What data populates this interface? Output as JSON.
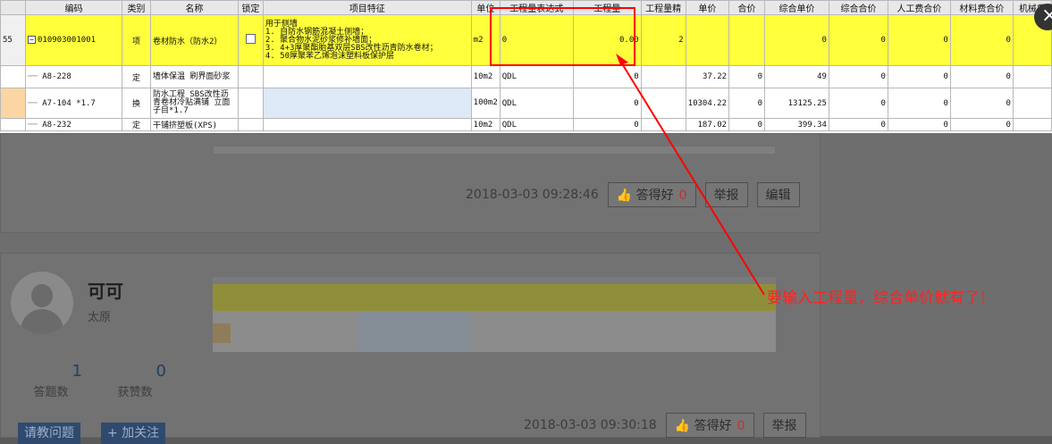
{
  "sheet": {
    "headers": [
      "编码",
      "类别",
      "名称",
      "锁定",
      "项目特征",
      "单位",
      "工程量表达式",
      "工程量",
      "工程量精",
      "单价",
      "合价",
      "综合单价",
      "综合合价",
      "人工费合价",
      "材料费合价",
      "机械费"
    ],
    "main_row": {
      "rownum": "55",
      "code": "010903001001",
      "type": "项",
      "name": "卷材防水（防水2）",
      "feature_lines": [
        "用于侧墙",
        "1. 自防水钢筋混凝土侧墙；",
        "2. 聚合物水泥砂浆修补墙面；",
        "3. 4+3厚聚酯胎基双层SBS改性沥青防水卷材；",
        "4. 50厚聚苯乙烯泡沫塑料板保护层"
      ],
      "unit": "m2",
      "expr": "0",
      "qty": "0.00",
      "precision": "2",
      "comp_price": "0",
      "comp_total": "0",
      "labor": "0",
      "material": "0"
    },
    "sub_rows": [
      {
        "code": "A8-228",
        "type": "定",
        "name": "墙体保温 刷界面砂浆",
        "unit": "10m2",
        "expr": "QDL",
        "qty": "0",
        "unit_price": "37.22",
        "total": "0",
        "comp_price": "49",
        "comp_total": "0",
        "labor": "0",
        "material": "0"
      },
      {
        "code": "A7-104 *1.7",
        "type": "换",
        "name": "防水工程 SBS改性沥青卷材冷贴满铺 立面 子目*1.7",
        "unit": "100m2",
        "expr": "QDL",
        "qty": "0",
        "unit_price": "10304.22",
        "total": "0",
        "comp_price": "13125.25",
        "comp_total": "0",
        "labor": "0",
        "material": "0"
      },
      {
        "code": "A8-232",
        "type": "定",
        "name": "干铺挤塑板(XPS)",
        "unit": "10m2",
        "expr": "QDL",
        "qty": "0",
        "unit_price": "187.02",
        "total": "0",
        "comp_price": "399.34",
        "comp_total": "0",
        "labor": "0",
        "material": "0"
      }
    ]
  },
  "answer1": {
    "timestamp": "2018-03-03 09:28:46",
    "like_label": "答得好",
    "like_count": "0",
    "report_label": "举报",
    "edit_label": "编辑"
  },
  "annotation": "要输入工程量，综合单价就有了！",
  "profile": {
    "name": "可可",
    "location": "太原",
    "answers": "1",
    "answers_label": "答题数",
    "likes": "0",
    "likes_label": "获赞数",
    "ask_label": "请教问题",
    "follow_label": "+ 加关注"
  },
  "answer2": {
    "timestamp": "2018-03-03 09:30:18",
    "like_label": "答得好",
    "like_count": "0",
    "report_label": "举报"
  },
  "close_label": "×"
}
